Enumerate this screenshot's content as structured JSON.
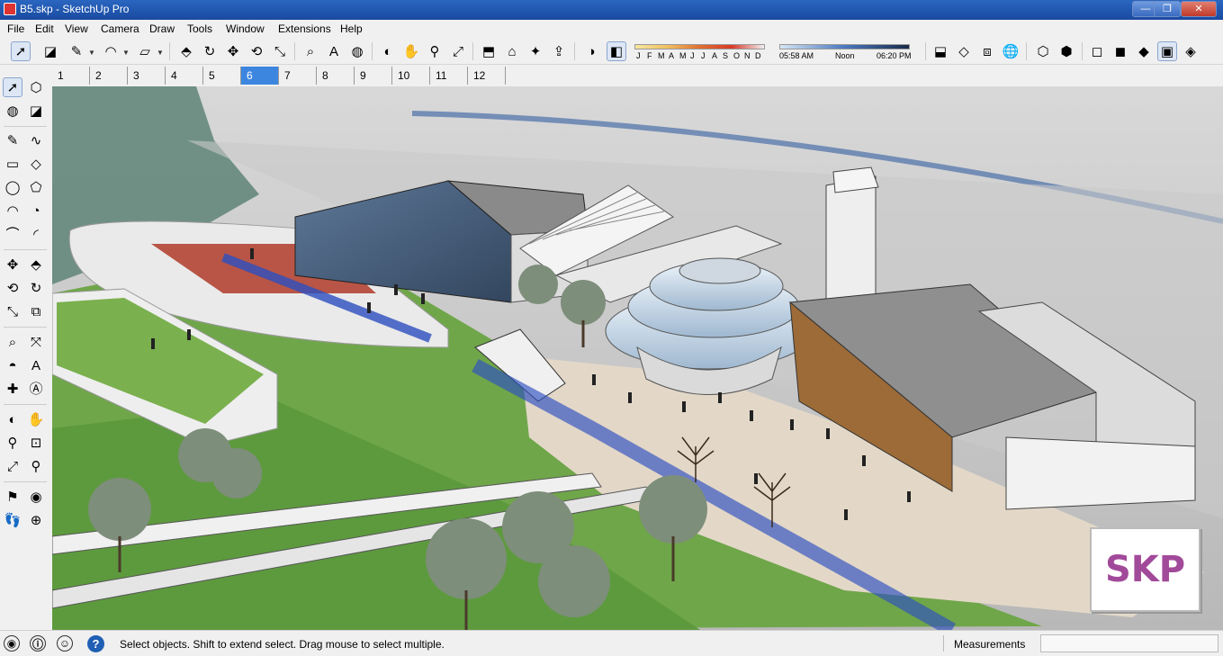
{
  "window": {
    "title": "B5.skp - SketchUp Pro",
    "minimize": "—",
    "maximize": "❐",
    "close": "✕"
  },
  "menu": [
    "File",
    "Edit",
    "View",
    "Camera",
    "Draw",
    "Tools",
    "Window",
    "Extensions",
    "Help"
  ],
  "toolbar": {
    "buttons": [
      {
        "name": "select-icon",
        "glyph": "➚"
      },
      {
        "name": "eraser-icon",
        "glyph": "◪"
      },
      {
        "name": "pencil-icon",
        "glyph": "✎"
      },
      {
        "name": "arc-icon",
        "glyph": "◠"
      },
      {
        "name": "rectangle-icon",
        "glyph": "▱"
      },
      {
        "name": "push-pull-icon",
        "glyph": "⬘"
      },
      {
        "name": "follow-me-icon",
        "glyph": "↻"
      },
      {
        "name": "move-icon",
        "glyph": "✥"
      },
      {
        "name": "rotate-icon",
        "glyph": "⟲"
      },
      {
        "name": "scale-icon",
        "glyph": "⤡"
      },
      {
        "name": "tape-measure-icon",
        "glyph": "⌕"
      },
      {
        "name": "text-icon",
        "glyph": "A"
      },
      {
        "name": "paint-bucket-icon",
        "glyph": "◍"
      },
      {
        "name": "orbit-icon",
        "glyph": "◐"
      },
      {
        "name": "pan-icon",
        "glyph": "✋"
      },
      {
        "name": "zoom-icon",
        "glyph": "⚲"
      },
      {
        "name": "zoom-extents-icon",
        "glyph": "⤢"
      },
      {
        "name": "components-icon",
        "glyph": "⬒"
      },
      {
        "name": "warehouse-icon",
        "glyph": "⌂"
      },
      {
        "name": "extension-icon",
        "glyph": "✦"
      },
      {
        "name": "share-icon",
        "glyph": "⇪"
      },
      {
        "name": "shadows-toggle-icon",
        "glyph": "◑"
      },
      {
        "name": "fog-icon",
        "glyph": "◧"
      }
    ],
    "right_buttons": [
      {
        "name": "section-plane-icon",
        "glyph": "⬓"
      },
      {
        "name": "section-display-icon",
        "glyph": "◇"
      },
      {
        "name": "section-cut-icon",
        "glyph": "⧈"
      },
      {
        "name": "globe-icon",
        "glyph": "🌐"
      },
      {
        "name": "xray-icon",
        "glyph": "⬡"
      },
      {
        "name": "back-edges-icon",
        "glyph": "⬢"
      },
      {
        "name": "wireframe-icon",
        "glyph": "◻"
      },
      {
        "name": "hidden-line-icon",
        "glyph": "◼"
      },
      {
        "name": "shaded-icon",
        "glyph": "◆"
      },
      {
        "name": "shaded-textures-icon",
        "glyph": "▣"
      },
      {
        "name": "monochrome-icon",
        "glyph": "◈"
      }
    ],
    "shadow_months": [
      "J",
      "F",
      "M",
      "A",
      "M",
      "J",
      "J",
      "A",
      "S",
      "O",
      "N",
      "D"
    ],
    "shadow_time": {
      "start": "05:58 AM",
      "mid": "Noon",
      "end": "06:20 PM"
    }
  },
  "scenes": [
    "1",
    "2",
    "3",
    "4",
    "5",
    "6",
    "7",
    "8",
    "9",
    "10",
    "11",
    "12"
  ],
  "selected_scene": "6",
  "left_toolbar": [
    {
      "name": "select-icon",
      "glyph": "➚"
    },
    {
      "name": "make-component-icon",
      "glyph": "⬡"
    },
    {
      "name": "paint-bucket-icon",
      "glyph": "◍"
    },
    {
      "name": "eraser-icon",
      "glyph": "◪"
    },
    {
      "name": "line-icon",
      "glyph": "✎"
    },
    {
      "name": "freehand-icon",
      "glyph": "∿"
    },
    {
      "name": "rectangle-icon",
      "glyph": "▭"
    },
    {
      "name": "rotated-rectangle-icon",
      "glyph": "◇"
    },
    {
      "name": "circle-icon",
      "glyph": "◯"
    },
    {
      "name": "polygon-icon",
      "glyph": "⬠"
    },
    {
      "name": "arc-icon",
      "glyph": "◠"
    },
    {
      "name": "pie-icon",
      "glyph": "◔"
    },
    {
      "name": "two-point-arc-icon",
      "glyph": "⌒"
    },
    {
      "name": "three-point-arc-icon",
      "glyph": "◜"
    },
    {
      "name": "move-icon",
      "glyph": "✥"
    },
    {
      "name": "push-pull-icon",
      "glyph": "⬘"
    },
    {
      "name": "rotate-icon",
      "glyph": "⟲"
    },
    {
      "name": "follow-me-icon",
      "glyph": "↻"
    },
    {
      "name": "scale-icon",
      "glyph": "⤡"
    },
    {
      "name": "offset-icon",
      "glyph": "⧉"
    },
    {
      "name": "tape-measure-icon",
      "glyph": "⌕"
    },
    {
      "name": "dimension-icon",
      "glyph": "⤧"
    },
    {
      "name": "protractor-icon",
      "glyph": "◓"
    },
    {
      "name": "text-icon",
      "glyph": "A"
    },
    {
      "name": "axes-icon",
      "glyph": "✚"
    },
    {
      "name": "3d-text-icon",
      "glyph": "Ⓐ"
    },
    {
      "name": "orbit-icon",
      "glyph": "◐"
    },
    {
      "name": "pan-icon",
      "glyph": "✋"
    },
    {
      "name": "zoom-icon",
      "glyph": "⚲"
    },
    {
      "name": "zoom-window-icon",
      "glyph": "⊡"
    },
    {
      "name": "zoom-extents-icon",
      "glyph": "⤢"
    },
    {
      "name": "previous-view-icon",
      "glyph": "⚲"
    },
    {
      "name": "position-camera-icon",
      "glyph": "⚑"
    },
    {
      "name": "look-around-icon",
      "glyph": "◉"
    },
    {
      "name": "walk-icon",
      "glyph": "👣"
    },
    {
      "name": "section-plane-icon",
      "glyph": "⊕"
    }
  ],
  "badge": {
    "text": "SKP"
  },
  "status": {
    "text": "Select objects. Shift to extend select. Drag mouse to select multiple.",
    "measurements_label": "Measurements",
    "measurements_value": "",
    "help_glyph": "?",
    "geo_glyph": "◉",
    "info_glyph": "ⓘ",
    "user_glyph": "☺"
  },
  "colors": {
    "titlebar": "#2a66c0",
    "scene_tab_selected": "#3c86e0",
    "skp_badge_text": "#a24a9a",
    "grass": "#6fa64a",
    "plaza": "#e3d8c8"
  }
}
